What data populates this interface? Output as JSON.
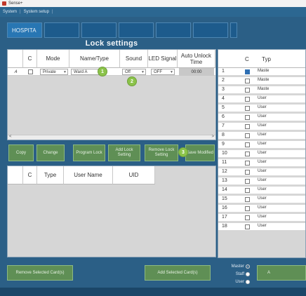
{
  "titlebar": {
    "title": "Sense+"
  },
  "menubar": {
    "items": [
      "System",
      "System setup"
    ]
  },
  "tabs": [
    {
      "label": "HOSPITA"
    },
    {
      "label": ""
    },
    {
      "label": ""
    },
    {
      "label": ""
    },
    {
      "label": ""
    },
    {
      "label": ""
    },
    {
      "label": ""
    }
  ],
  "panel_title": "Lock settings",
  "lock_table": {
    "headers": [
      "C",
      "Mode",
      "Name/Type",
      "Sound",
      "LED Signal",
      "Auto Unlock Time"
    ],
    "row": {
      "marker": ".4",
      "mode": "Private",
      "name": "Ward A",
      "sound": "Off",
      "led": "OFF",
      "time": "00:00"
    }
  },
  "badges": [
    "1",
    "2",
    "3"
  ],
  "buttons": {
    "copy": "Copy",
    "change": "Change",
    "program": "Program Lock",
    "add_setting": "Add Lock Setting",
    "remove_setting": "Remove Lock Setting",
    "save": "Save Modified"
  },
  "user_table": {
    "headers": [
      "C",
      "Type",
      "User Name",
      "UID"
    ]
  },
  "card_table": {
    "headers": [
      "C",
      "Typ"
    ],
    "rows": [
      {
        "num": "1",
        "type": "Maste",
        "selected": true
      },
      {
        "num": "2",
        "type": "Maste",
        "selected": false
      },
      {
        "num": "3",
        "type": "Maste",
        "selected": false
      },
      {
        "num": "4",
        "type": "User",
        "selected": false
      },
      {
        "num": "5",
        "type": "User",
        "selected": false
      },
      {
        "num": "6",
        "type": "User",
        "selected": false
      },
      {
        "num": "7",
        "type": "User",
        "selected": false
      },
      {
        "num": "8",
        "type": "User",
        "selected": false
      },
      {
        "num": "9",
        "type": "User",
        "selected": false
      },
      {
        "num": "10",
        "type": "User",
        "selected": false
      },
      {
        "num": "11",
        "type": "User",
        "selected": false
      },
      {
        "num": "12",
        "type": "User",
        "selected": false
      },
      {
        "num": "13",
        "type": "User",
        "selected": false
      },
      {
        "num": "14",
        "type": "User",
        "selected": false
      },
      {
        "num": "15",
        "type": "User",
        "selected": false
      },
      {
        "num": "16",
        "type": "User",
        "selected": false
      },
      {
        "num": "17",
        "type": "User",
        "selected": false
      },
      {
        "num": "18",
        "type": "User",
        "selected": false
      }
    ]
  },
  "bottom": {
    "remove_cards": "Remove Selected Card(s)",
    "add_cards": "Add Selected Card(s)",
    "radio": [
      "Master",
      "Staff",
      "User"
    ],
    "partial_button": "A"
  }
}
